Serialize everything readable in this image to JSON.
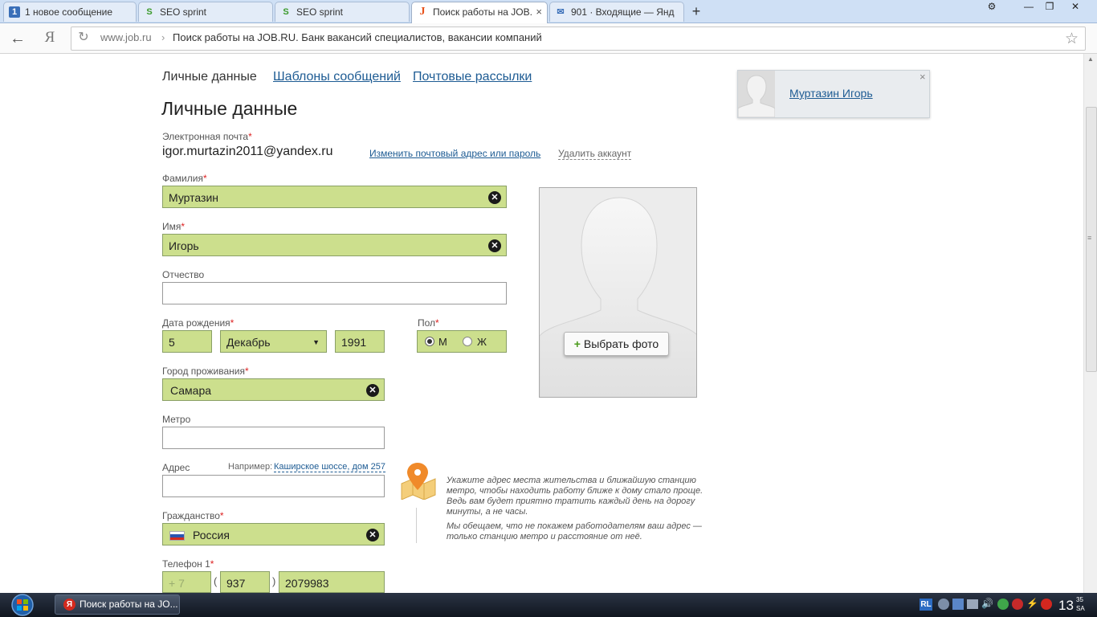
{
  "browser": {
    "tabs": [
      {
        "label": "1 новое сообщение",
        "icon": "1"
      },
      {
        "label": "SEO sprint",
        "icon": "S"
      },
      {
        "label": "SEO sprint",
        "icon": "S"
      },
      {
        "label": "Поиск работы на JOB.",
        "icon": "J",
        "close": "×"
      },
      {
        "label": "901 · Входящие — Янд",
        "icon": "✉"
      }
    ],
    "new_tab": "+",
    "window_controls": [
      "⚙",
      "—",
      "❐",
      "✕"
    ],
    "yandex_logo": "Я",
    "address": {
      "domain": "www.job.ru",
      "separator": "›",
      "title": "Поиск работы на JOB.RU. Банк вакансий специалистов, вакансии компаний"
    }
  },
  "nav": {
    "current": "Личные данные",
    "links": [
      "Шаблоны сообщений",
      "Почтовые рассылки"
    ]
  },
  "user_card": {
    "name": "Муртазин Игорь",
    "close": "×"
  },
  "page_title": "Личные данные",
  "form": {
    "email": {
      "label": "Электронная почта",
      "required": "*",
      "value": "igor.murtazin2011@yandex.ru",
      "change_link": "Изменить почтовый адрес или пароль",
      "delete_link": "Удалить аккаунт"
    },
    "surname": {
      "label": "Фамилия",
      "required": "*",
      "value": "Муртазин"
    },
    "name": {
      "label": "Имя",
      "required": "*",
      "value": "Игорь"
    },
    "patronymic": {
      "label": "Отчество",
      "value": ""
    },
    "birth": {
      "label": "Дата рождения",
      "required": "*",
      "day": "5",
      "month": "Декабрь",
      "year": "1991"
    },
    "gender": {
      "label": "Пол",
      "required": "*",
      "male": "М",
      "female": "Ж",
      "selected": "М"
    },
    "city": {
      "label": "Город проживания",
      "required": "*",
      "value": "Самара"
    },
    "metro": {
      "label": "Метро",
      "value": ""
    },
    "address": {
      "label": "Адрес",
      "example_prefix": "Например:",
      "example_link": "Каширское шоссе, дом 257",
      "value": ""
    },
    "citizenship": {
      "label": "Гражданство",
      "required": "*",
      "value": "Россия"
    },
    "phone": {
      "label": "Телефон 1",
      "required": "*",
      "country": "+ 7",
      "open_paren": "(",
      "code": "937",
      "close_paren": ")",
      "number": "2079983"
    }
  },
  "photo": {
    "button_plus": "+",
    "button_label": "Выбрать фото"
  },
  "address_hint": {
    "text1": "Укажите адрес места жительства и ближайшую станцию метро, чтобы находить работу ближе к дому стало проще. Ведь вам будет приятно тратить каждый день на дорогу минуты, а не часы.",
    "text2": "Мы обещаем, что не покажем работодателям ваш адрес — только станцию метро и расстояние от неё."
  },
  "taskbar": {
    "item_label": "Поиск работы на JO...",
    "language": "RL",
    "time_hour": "13",
    "time_minute": "35",
    "time_suffix": "SA"
  },
  "colors": {
    "filled_field": "#ccdf8d",
    "link": "#1d5b93",
    "required": "#dd2222"
  }
}
